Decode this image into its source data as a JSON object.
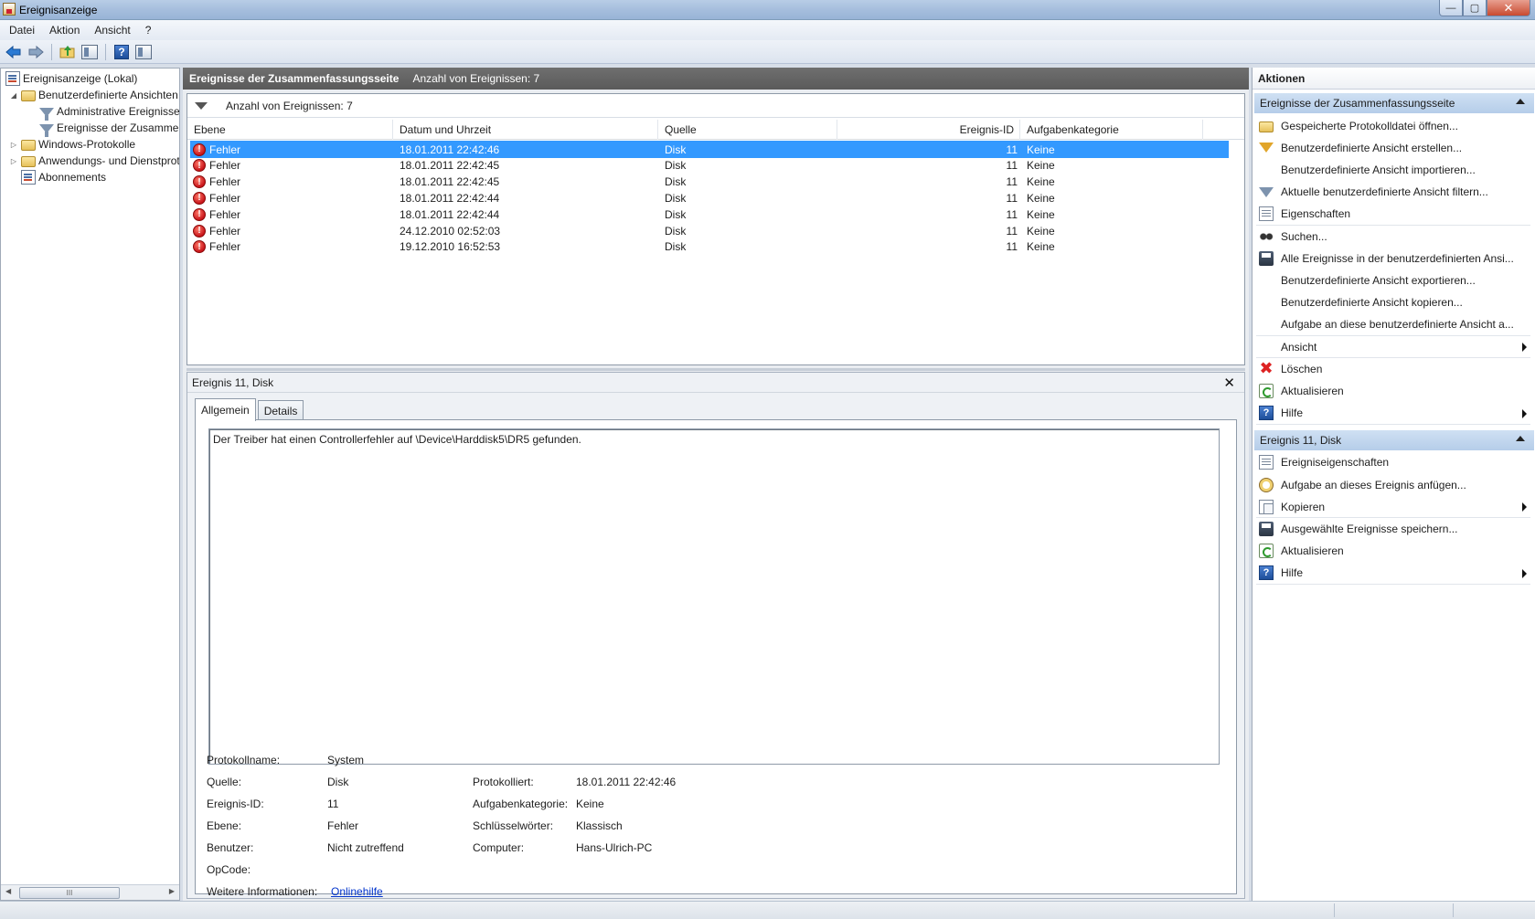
{
  "window": {
    "title": "Ereignisanzeige",
    "buttons": {
      "minimize": "—",
      "maximize": "▢",
      "close": "✕"
    }
  },
  "menu": [
    "Datei",
    "Aktion",
    "Ansicht",
    "?"
  ],
  "toolbar": {
    "icons": [
      "back-arrow-icon",
      "forward-arrow-icon",
      "up-folder-icon",
      "show-hide-tree-icon",
      "help-icon",
      "show-hide-actions-icon"
    ]
  },
  "tree": {
    "items": [
      {
        "label": "Ereignisanzeige (Lokal)",
        "level": 0,
        "expander": "",
        "icon": "event-viewer-icon"
      },
      {
        "label": "Benutzerdefinierte Ansichten",
        "level": 1,
        "expander": "◢",
        "icon": "folder-icon"
      },
      {
        "label": "Administrative Ereignisse",
        "level": 2,
        "expander": "",
        "icon": "filter-icon"
      },
      {
        "label": "Ereignisse der Zusammenfassungsseite",
        "level": 2,
        "expander": "",
        "icon": "filter-icon"
      },
      {
        "label": "Windows-Protokolle",
        "level": 1,
        "expander": "▷",
        "icon": "folder-icon"
      },
      {
        "label": "Anwendungs- und Dienstprotokolle",
        "level": 1,
        "expander": "▷",
        "icon": "folder-icon"
      },
      {
        "label": "Abonnements",
        "level": 1,
        "expander": "",
        "icon": "log-icon"
      }
    ],
    "hscroll_thumb": "III"
  },
  "center": {
    "header_title": "Ereignisse der Zusammenfassungsseite",
    "header_count": "Anzahl von Ereignissen: 7",
    "filter_text": "Anzahl von Ereignissen: 7",
    "columns": [
      "Ebene",
      "Datum und Uhrzeit",
      "Quelle",
      "Ereignis-ID",
      "Aufgabenkategorie"
    ],
    "rows": [
      {
        "level": "Fehler",
        "datetime": "18.01.2011 22:42:46",
        "source": "Disk",
        "id": "11",
        "category": "Keine",
        "selected": true
      },
      {
        "level": "Fehler",
        "datetime": "18.01.2011 22:42:45",
        "source": "Disk",
        "id": "11",
        "category": "Keine",
        "selected": false
      },
      {
        "level": "Fehler",
        "datetime": "18.01.2011 22:42:45",
        "source": "Disk",
        "id": "11",
        "category": "Keine",
        "selected": false
      },
      {
        "level": "Fehler",
        "datetime": "18.01.2011 22:42:44",
        "source": "Disk",
        "id": "11",
        "category": "Keine",
        "selected": false
      },
      {
        "level": "Fehler",
        "datetime": "18.01.2011 22:42:44",
        "source": "Disk",
        "id": "11",
        "category": "Keine",
        "selected": false
      },
      {
        "level": "Fehler",
        "datetime": "24.12.2010 02:52:03",
        "source": "Disk",
        "id": "11",
        "category": "Keine",
        "selected": false
      },
      {
        "level": "Fehler",
        "datetime": "19.12.2010 16:52:53",
        "source": "Disk",
        "id": "11",
        "category": "Keine",
        "selected": false
      }
    ]
  },
  "detail": {
    "header": "Ereignis 11, Disk",
    "close": "✕",
    "tabs": [
      {
        "label": "Allgemein",
        "active": true
      },
      {
        "label": "Details",
        "active": false
      }
    ],
    "description": "Der Treiber hat einen Controllerfehler auf \\Device\\Harddisk5\\DR5 gefunden.",
    "properties_left": [
      {
        "label": "Protokollname:",
        "value": "System"
      },
      {
        "label": "Quelle:",
        "value": "Disk"
      },
      {
        "label": "Ereignis-ID:",
        "value": "11"
      },
      {
        "label": "Ebene:",
        "value": "Fehler"
      },
      {
        "label": "Benutzer:",
        "value": "Nicht zutreffend"
      },
      {
        "label": "OpCode:",
        "value": ""
      },
      {
        "label": "Weitere Informationen:",
        "value": "Onlinehilfe",
        "link": true
      }
    ],
    "properties_right": [
      {
        "label": "Protokolliert:",
        "value": "18.01.2011 22:42:46"
      },
      {
        "label": "Aufgabenkategorie:",
        "value": "Keine"
      },
      {
        "label": "Schlüsselwörter:",
        "value": "Klassisch"
      },
      {
        "label": "Computer:",
        "value": "Hans-Ulrich-PC"
      }
    ]
  },
  "actions": {
    "title": "Aktionen",
    "sections": [
      {
        "title": "Ereignisse der Zusammenfassungsseite",
        "items": [
          {
            "label": "Gespeicherte Protokolldatei öffnen...",
            "icon": "open-folder-icon",
            "submenu": false
          },
          {
            "label": "Benutzerdefinierte Ansicht erstellen...",
            "icon": "create-filter-icon",
            "submenu": false
          },
          {
            "label": "Benutzerdefinierte Ansicht importieren...",
            "icon": "none",
            "submenu": false
          },
          {
            "label": "Aktuelle benutzerdefinierte Ansicht filtern...",
            "icon": "filter-icon",
            "submenu": false
          },
          {
            "label": "Eigenschaften",
            "icon": "properties-icon",
            "submenu": false
          },
          {
            "label": "Suchen...",
            "icon": "binoculars-icon",
            "submenu": false
          },
          {
            "label": "Alle Ereignisse in der benutzerdefinierten Ansi...",
            "icon": "save-icon",
            "submenu": false
          },
          {
            "label": "Benutzerdefinierte Ansicht exportieren...",
            "icon": "none",
            "submenu": false
          },
          {
            "label": "Benutzerdefinierte Ansicht kopieren...",
            "icon": "none",
            "submenu": false
          },
          {
            "label": "Aufgabe an diese benutzerdefinierte Ansicht a...",
            "icon": "none",
            "submenu": false
          },
          {
            "label": "Ansicht",
            "icon": "none",
            "submenu": true
          },
          {
            "label": "Löschen",
            "icon": "delete-icon",
            "submenu": false
          },
          {
            "label": "Aktualisieren",
            "icon": "refresh-icon",
            "submenu": false
          },
          {
            "label": "Hilfe",
            "icon": "help-icon",
            "submenu": true
          }
        ]
      },
      {
        "title": "Ereignis 11, Disk",
        "items": [
          {
            "label": "Ereigniseigenschaften",
            "icon": "properties-icon",
            "submenu": false
          },
          {
            "label": "Aufgabe an dieses Ereignis anfügen...",
            "icon": "task-icon",
            "submenu": false
          },
          {
            "label": "Kopieren",
            "icon": "copy-icon",
            "submenu": true
          },
          {
            "label": "Ausgewählte Ereignisse speichern...",
            "icon": "save-icon",
            "submenu": false
          },
          {
            "label": "Aktualisieren",
            "icon": "refresh-icon",
            "submenu": false
          },
          {
            "label": "Hilfe",
            "icon": "help-icon",
            "submenu": true
          }
        ]
      }
    ]
  }
}
